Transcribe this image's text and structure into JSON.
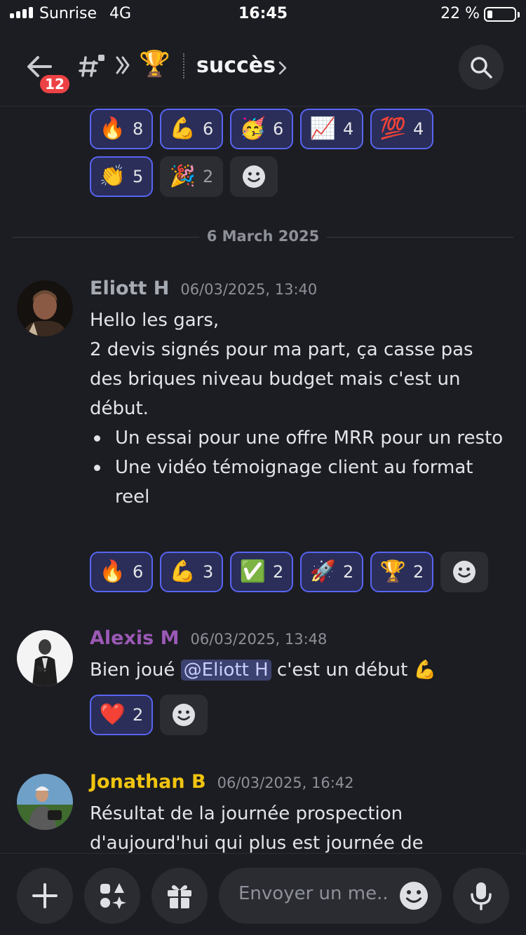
{
  "status_bar": {
    "carrier": "Sunrise",
    "network": "4G",
    "time": "16:45",
    "battery": "22 %"
  },
  "header": {
    "unread_badge": "12",
    "trophy_emoji": "🏆",
    "channel_name": "succès"
  },
  "previous_message_reactions": {
    "row1": [
      {
        "emoji": "🔥",
        "count": "8"
      },
      {
        "emoji": "💪",
        "count": "6"
      },
      {
        "emoji": "🥳",
        "count": "6"
      },
      {
        "emoji": "📈",
        "count": "4"
      },
      {
        "emoji": "💯",
        "count": "4"
      }
    ],
    "row2": [
      {
        "emoji": "👏",
        "count": "5"
      },
      {
        "emoji": "🎉",
        "count": "2"
      }
    ]
  },
  "date_separator": "6 March 2025",
  "messages": [
    {
      "author": "Eliott H",
      "author_color": "#a6abb3",
      "timestamp": "06/03/2025, 13:40",
      "lines": [
        "Hello les gars,",
        "2 devis signés pour ma part, ça casse pas des briques niveau budget mais c'est un début."
      ],
      "bullets": [
        "Un essai pour une offre MRR pour un resto",
        "Une vidéo témoignage client au format reel"
      ],
      "reactions": [
        {
          "emoji": "🔥",
          "count": "6"
        },
        {
          "emoji": "💪",
          "count": "3"
        },
        {
          "emoji": "✅",
          "count": "2"
        },
        {
          "emoji": "🚀",
          "count": "2"
        },
        {
          "emoji": "🏆",
          "count": "2"
        }
      ]
    },
    {
      "author": "Alexis M",
      "author_color": "#9b59b6",
      "timestamp": "06/03/2025, 13:48",
      "text_before": "Bien joué ",
      "mention": "@Eliott H",
      "text_after": " c'est un début 💪",
      "reactions": [
        {
          "emoji": "❤️",
          "count": "2"
        }
      ]
    },
    {
      "author": "Jonathan B",
      "author_color": "#f1c40f",
      "timestamp": "06/03/2025, 16:42",
      "text": "Résultat de la journée prospection d'aujourd'hui qui plus est journée de"
    }
  ],
  "composer": {
    "placeholder": "Envoyer un me.."
  },
  "colors": {
    "background": "#1c1d22",
    "reaction_active_bg": "#2a2e59",
    "reaction_active_border": "#5865f2",
    "badge_red": "#ed4245"
  }
}
